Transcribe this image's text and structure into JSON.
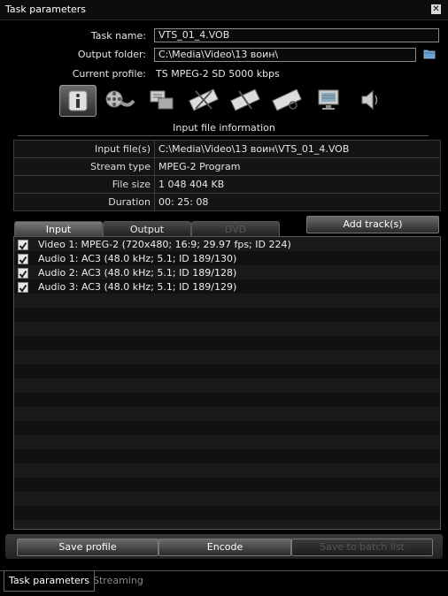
{
  "window": {
    "title": "Task parameters"
  },
  "form": {
    "task_name_label": "Task name:",
    "task_name_value": "VTS_01_4.VOB",
    "output_folder_label": "Output folder:",
    "output_folder_value": "C:\\Media\\Video\\13 воин\\",
    "current_profile_label": "Current profile:",
    "current_profile_value": "TS MPEG-2 SD 5000 kbps"
  },
  "toolbar": {
    "icons": [
      "info-icon",
      "film-reel-icon",
      "converter-icon",
      "film-cut-icon",
      "film-cut-icon",
      "film-edit-icon",
      "monitor-icon",
      "speaker-icon"
    ]
  },
  "section": {
    "title": "Input file information"
  },
  "info_table": [
    {
      "key": "Input file(s)",
      "value": "C:\\Media\\Video\\13 воин\\VTS_01_4.VOB"
    },
    {
      "key": "Stream type",
      "value": "MPEG-2 Program"
    },
    {
      "key": "File size",
      "value": "1 048 404 KB"
    },
    {
      "key": "Duration",
      "value": "00: 25: 08"
    }
  ],
  "tabs": [
    {
      "label": "Input",
      "state": "active"
    },
    {
      "label": "Output",
      "state": "normal"
    },
    {
      "label": "DVD",
      "state": "disabled"
    }
  ],
  "add_tracks_label": "Add track(s)",
  "tracks": [
    {
      "checked": true,
      "label": "Video 1: MPEG-2  (720x480; 16:9; 29.97 fps; ID 224)"
    },
    {
      "checked": true,
      "label": "Audio 1: AC3  (48.0 kHz; 5.1; ID 189/130)"
    },
    {
      "checked": true,
      "label": "Audio 2: AC3  (48.0 kHz; 5.1; ID 189/128)"
    },
    {
      "checked": true,
      "label": "Audio 3: AC3  (48.0 kHz; 5.1; ID 189/129)"
    }
  ],
  "actions": {
    "save_profile": "Save profile",
    "encode": "Encode",
    "save_to_batch": "Save to batch list"
  },
  "bottom_tabs": {
    "task_parameters": "Task parameters",
    "streaming": "Streaming"
  }
}
